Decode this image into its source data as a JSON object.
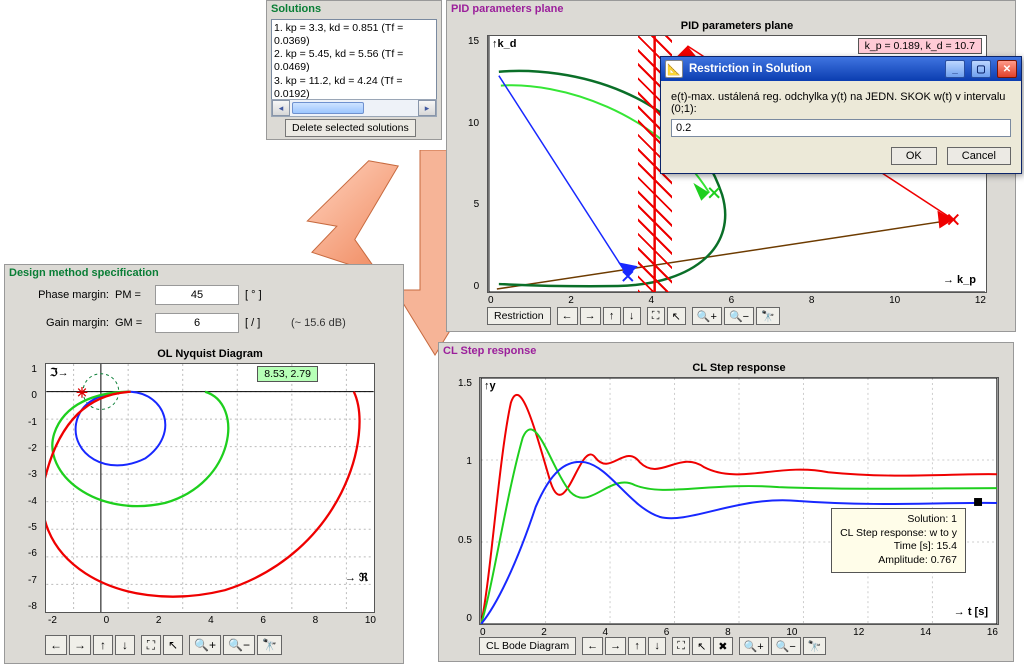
{
  "solutions": {
    "title": "Solutions",
    "items": [
      "1. kp = 3.3, kd = 0.851 (Tf = 0.0369)",
      "2. kp = 5.45, kd = 5.56 (Tf = 0.0469)",
      "3. kp = 11.2, kd = 4.24 (Tf = 0.0192)"
    ],
    "delete_label": "Delete selected solutions"
  },
  "design": {
    "title": "Design method specification",
    "phase_label": "Phase margin:",
    "phase_var": "PM =",
    "phase_val": "45",
    "phase_unit": "[ ° ]",
    "gain_label": "Gain margin:",
    "gain_var": "GM =",
    "gain_val": "6",
    "gain_unit": "[ / ]",
    "gain_note": "(~ 15.6 dB)"
  },
  "nyquist": {
    "title": "OL Nyquist Diagram",
    "readout": "8.53, 2.79",
    "xaxis": "ℜ",
    "yaxis": "ℑ"
  },
  "pid": {
    "panel_title": "PID parameters plane",
    "plot_title": "PID parameters plane",
    "readout": "k_p = 0.189, k_d = 10.7",
    "xaxis": "k_p",
    "yaxis": "k_d",
    "restriction_btn": "Restriction"
  },
  "cl": {
    "panel_title": "CL Step response",
    "plot_title": "CL Step response",
    "xaxis": "t [s]",
    "yaxis": "y",
    "bode_btn": "CL Bode Diagram",
    "info": {
      "l1": "Solution: 1",
      "l2": "CL Step response: w to y",
      "l3": "Time [s]: 15.4",
      "l4": "Amplitude: 0.767"
    }
  },
  "dialog": {
    "title": "Restriction in Solution",
    "prompt": "e(t)-max. ustálená reg. odchylka y(t) na JEDN. SKOK w(t) v intervalu (0;1):",
    "value": "0.2",
    "ok": "OK",
    "cancel": "Cancel"
  },
  "toolbar": {
    "left": "←",
    "right": "→",
    "up": "↑",
    "down": "↓",
    "select": "⛶",
    "pointer": "↖",
    "zoom_in": "🔍+",
    "zoom_out": "🔍−",
    "binoc": "🔭",
    "cross": "✖"
  },
  "chart_data": [
    {
      "id": "pid_parameters_plane",
      "type": "scatter",
      "title": "PID parameters plane",
      "xlabel": "k_p",
      "ylabel": "k_d",
      "xlim": [
        0,
        12
      ],
      "ylim": [
        0,
        15
      ],
      "x_ticks": [
        0,
        2,
        4,
        6,
        8,
        10,
        12
      ],
      "y_ticks": [
        0,
        5,
        10,
        15
      ],
      "solution_markers": [
        {
          "name": "Solution 1",
          "kp": 3.3,
          "kd": 0.851,
          "color": "blue"
        },
        {
          "name": "Solution 2",
          "kp": 5.45,
          "kd": 5.56,
          "color": "green"
        },
        {
          "name": "Solution 3",
          "kp": 11.2,
          "kd": 4.24,
          "color": "red"
        }
      ],
      "cursor_readout": {
        "kp": 0.189,
        "kd": 10.7
      },
      "restriction_boundary_kp": 4.0,
      "stability_boundary_curve": "dark-green loop from (~0.2,12.8) through (~5.8,5.6) back to (~0.2,0.2)",
      "linear_trend_line": {
        "approx_points": [
          [
            0,
            0.1
          ],
          [
            11.2,
            4.24
          ]
        ],
        "color": "brown"
      }
    },
    {
      "id": "ol_nyquist",
      "type": "line",
      "title": "OL Nyquist Diagram",
      "xlabel": "Re",
      "ylabel": "Im",
      "xlim": [
        -2,
        10
      ],
      "ylim": [
        -8,
        1
      ],
      "x_ticks": [
        -2,
        0,
        2,
        4,
        6,
        8,
        10
      ],
      "y_ticks": [
        -8,
        -7,
        -6,
        -5,
        -4,
        -3,
        -2,
        -1,
        0,
        1
      ],
      "series": [
        {
          "name": "Solution 1 (blue)",
          "color": "blue"
        },
        {
          "name": "Solution 2 (green)",
          "color": "green"
        },
        {
          "name": "Solution 3 (red)",
          "color": "red"
        }
      ],
      "critical_point": [
        -1,
        0
      ],
      "cursor_readout": {
        "re": 8.53,
        "im": 2.79
      }
    },
    {
      "id": "cl_step_response",
      "type": "line",
      "title": "CL Step response",
      "xlabel": "t [s]",
      "ylabel": "y",
      "xlim": [
        0,
        16
      ],
      "ylim": [
        0,
        1.5
      ],
      "x_ticks": [
        0,
        2,
        4,
        6,
        8,
        10,
        12,
        14,
        16
      ],
      "y_ticks": [
        0,
        0.5,
        1,
        1.5
      ],
      "series": [
        {
          "name": "Solution 1",
          "color": "blue",
          "steady_state": 0.77,
          "overshoot_peak": 1.02,
          "peak_time": 2.4
        },
        {
          "name": "Solution 2",
          "color": "green",
          "steady_state": 0.85,
          "overshoot_peak": 1.17,
          "peak_time": 1.3
        },
        {
          "name": "Solution 3",
          "color": "red",
          "steady_state": 0.9,
          "overshoot_peak": 1.44,
          "peak_time": 0.9
        }
      ],
      "data_tip": {
        "solution": 1,
        "time_s": 15.4,
        "amplitude": 0.767
      }
    }
  ]
}
